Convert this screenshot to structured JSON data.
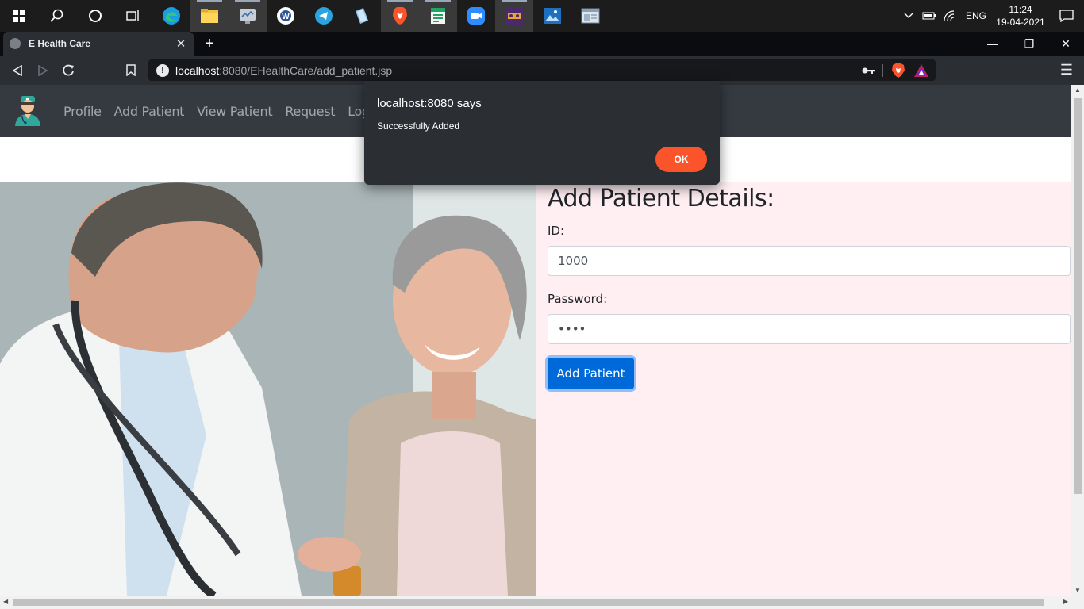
{
  "taskbar": {
    "apps": [
      "windows-start",
      "search",
      "cortana",
      "task-view",
      "edge",
      "file-explorer",
      "system-monitor",
      "app-w",
      "telegram",
      "notepad",
      "brave",
      "sheets",
      "zoom",
      "game-app",
      "photos",
      "window-app"
    ],
    "tray": {
      "language": "ENG",
      "time": "11:24",
      "date": "19-04-2021"
    }
  },
  "browser": {
    "tab_title": "E Health Care",
    "url_host": "localhost",
    "url_path": ":8080/EHealthCare/add_patient.jsp"
  },
  "navbar": {
    "links": [
      "Profile",
      "Add Patient",
      "View Patient",
      "Request",
      "Logout"
    ]
  },
  "form": {
    "heading": "Add Patient Details:",
    "id_label": "ID:",
    "id_value": "1000",
    "password_label": "Password:",
    "password_value": "••••",
    "submit_label": "Add Patient"
  },
  "dialog": {
    "title": "localhost:8080 says",
    "message": "Successfully Added",
    "ok_label": "OK"
  },
  "colors": {
    "navbar_bg": "#343a40",
    "form_bg": "#ffeef2",
    "primary_button": "#0069d9",
    "dialog_ok": "#fb542b"
  }
}
